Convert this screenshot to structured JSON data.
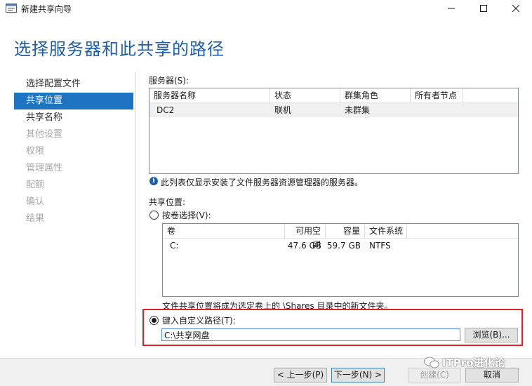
{
  "window": {
    "title": "新建共享向导"
  },
  "page_title": "选择服务器和此共享的路径",
  "steps": [
    {
      "label": "选择配置文件",
      "state": "done"
    },
    {
      "label": "共享位置",
      "state": "active"
    },
    {
      "label": "共享名称",
      "state": "done"
    },
    {
      "label": "其他设置",
      "state": "disabled"
    },
    {
      "label": "权限",
      "state": "disabled"
    },
    {
      "label": "管理属性",
      "state": "disabled"
    },
    {
      "label": "配额",
      "state": "disabled"
    },
    {
      "label": "确认",
      "state": "disabled"
    },
    {
      "label": "结果",
      "state": "disabled"
    }
  ],
  "servers": {
    "label": "服务器(S):",
    "columns": [
      "服务器名称",
      "状态",
      "群集角色",
      "所有者节点"
    ],
    "rows": [
      [
        "DC2",
        "联机",
        "未群集",
        ""
      ]
    ],
    "info": "此列表仅显示安装了文件服务器资源管理器的服务器。"
  },
  "share_location": {
    "label": "共享位置:",
    "by_volume_label": "按卷选择(V):",
    "volume_columns": [
      "卷",
      "可用空间",
      "容量",
      "文件系统"
    ],
    "volume_rows": [
      [
        "C:",
        "47.6 GB",
        "59.7 GB",
        "NTFS"
      ]
    ],
    "volume_note": "文件共享位置将成为选定卷上的 \\Shares 目录中的新文件夹。",
    "custom_path_label": "键入自定义路径(T):",
    "custom_path_value": "C:\\共享网盘",
    "browse_label": "浏览(B)..."
  },
  "footer": {
    "prev_label": "< 上一步(P)",
    "next_label": "下一步(N) >",
    "create_label": "创建(C)",
    "cancel_label": "取消",
    "watermark": "ITPro进化论"
  },
  "colors": {
    "accent": "#1e74c0",
    "heading": "#1e5fa8",
    "highlight_box": "#d9232d"
  }
}
